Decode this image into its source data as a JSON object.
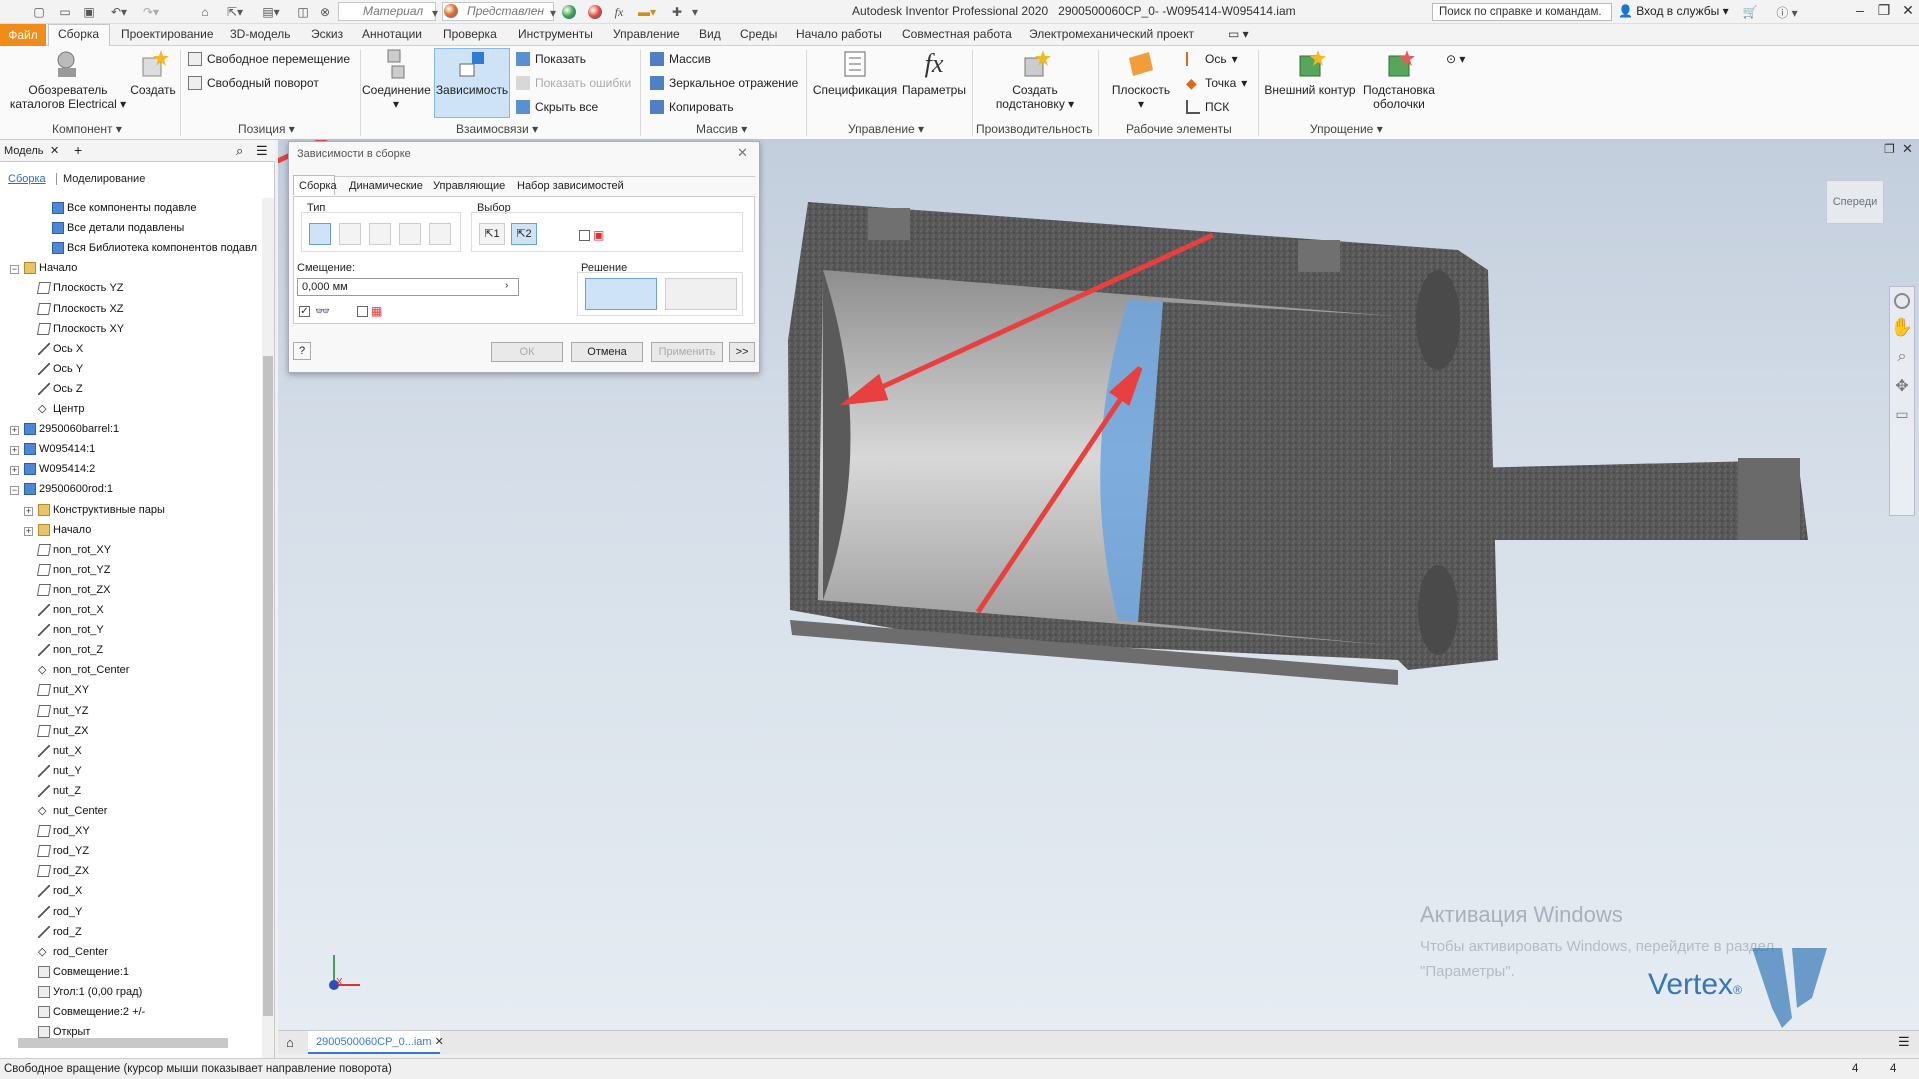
{
  "titlebar": {
    "material_value": "Материал",
    "appearance_value": "Представлен",
    "app_title": "Autodesk Inventor Professional 2020",
    "document_name": "2900500060CP_0-  -W095414-W095414.iam",
    "help_search": "Поиск по справке и командам.",
    "signin": "Вход в службы"
  },
  "menu": {
    "file": "Файл",
    "tabs": [
      "Сборка",
      "Проектирование",
      "3D-модель",
      "Эскиз",
      "Аннотации",
      "Проверка",
      "Инструменты",
      "Управление",
      "Вид",
      "Среды",
      "Начало работы",
      "Совместная работа",
      "Электромеханический проект"
    ]
  },
  "ribbon": {
    "catalog_browser": "Обозреватель каталогов Electrical",
    "create": "Создать",
    "free_move": "Свободное перемещение",
    "free_rotate": "Свободный поворот",
    "joint": "Соединение",
    "constraint": "Зависимость",
    "show": "Показать",
    "show_errors": "Показать ошибки",
    "hide_all": "Скрыть все",
    "pattern": "Массив",
    "mirror": "Зеркальное отражение",
    "copy": "Копировать",
    "bom": "Спецификация",
    "parameters": "Параметры",
    "create_substitute": "Создать подстановку",
    "plane": "Плоскость",
    "axis": "Ось",
    "point": "Точка",
    "ucs": "ПСК",
    "shrinkwrap": "Внешний контур",
    "shrinkwrap_sub": "Подстановка оболочки",
    "groups": {
      "component": "Компонент",
      "position": "Позиция",
      "relationships": "Взаимосвязи",
      "pattern": "Массив",
      "manage": "Управление",
      "productivity": "Производительность",
      "work_features": "Рабочие элементы",
      "simplification": "Упрощение"
    }
  },
  "browser": {
    "model_tab": "Модель",
    "assembly": "Сборка",
    "modeling": "Моделирование",
    "items": [
      {
        "label": "Все компоненты подавле",
        "indent": 3,
        "icon": "part"
      },
      {
        "label": "Все детали подавлены",
        "indent": 3,
        "icon": "part"
      },
      {
        "label": "Вся Библиотека компонентов подавл",
        "indent": 3,
        "icon": "part"
      },
      {
        "label": "Начало",
        "indent": 1,
        "icon": "folder",
        "exp": "−"
      },
      {
        "label": "Плоскость YZ",
        "indent": 2,
        "icon": "plane"
      },
      {
        "label": "Плоскость XZ",
        "indent": 2,
        "icon": "plane"
      },
      {
        "label": "Плоскость XY",
        "indent": 2,
        "icon": "plane"
      },
      {
        "label": "Ось X",
        "indent": 2,
        "icon": "axis"
      },
      {
        "label": "Ось Y",
        "indent": 2,
        "icon": "axis"
      },
      {
        "label": "Ось Z",
        "indent": 2,
        "icon": "axis"
      },
      {
        "label": "Центр",
        "indent": 2,
        "icon": "point"
      },
      {
        "label": "2950060barrel:1",
        "indent": 1,
        "icon": "part",
        "exp": "+"
      },
      {
        "label": "W095414:1",
        "indent": 1,
        "icon": "part",
        "exp": "+"
      },
      {
        "label": "W095414:2",
        "indent": 1,
        "icon": "part",
        "exp": "+"
      },
      {
        "label": "29500600rod:1",
        "indent": 1,
        "icon": "part",
        "exp": "−"
      },
      {
        "label": "Конструктивные пары",
        "indent": 2,
        "icon": "folder",
        "exp": "+"
      },
      {
        "label": "Начало",
        "indent": 2,
        "icon": "folder",
        "exp": "+"
      },
      {
        "label": "non_rot_XY",
        "indent": 2,
        "icon": "plane"
      },
      {
        "label": "non_rot_YZ",
        "indent": 2,
        "icon": "plane"
      },
      {
        "label": "non_rot_ZX",
        "indent": 2,
        "icon": "plane"
      },
      {
        "label": "non_rot_X",
        "indent": 2,
        "icon": "axis"
      },
      {
        "label": "non_rot_Y",
        "indent": 2,
        "icon": "axis"
      },
      {
        "label": "non_rot_Z",
        "indent": 2,
        "icon": "axis"
      },
      {
        "label": "non_rot_Center",
        "indent": 2,
        "icon": "point"
      },
      {
        "label": "nut_XY",
        "indent": 2,
        "icon": "plane"
      },
      {
        "label": "nut_YZ",
        "indent": 2,
        "icon": "plane"
      },
      {
        "label": "nut_ZX",
        "indent": 2,
        "icon": "plane"
      },
      {
        "label": "nut_X",
        "indent": 2,
        "icon": "axis"
      },
      {
        "label": "nut_Y",
        "indent": 2,
        "icon": "axis"
      },
      {
        "label": "nut_Z",
        "indent": 2,
        "icon": "axis"
      },
      {
        "label": "nut_Center",
        "indent": 2,
        "icon": "point"
      },
      {
        "label": "rod_XY",
        "indent": 2,
        "icon": "plane"
      },
      {
        "label": "rod_YZ",
        "indent": 2,
        "icon": "plane"
      },
      {
        "label": "rod_ZX",
        "indent": 2,
        "icon": "plane"
      },
      {
        "label": "rod_X",
        "indent": 2,
        "icon": "axis"
      },
      {
        "label": "rod_Y",
        "indent": 2,
        "icon": "axis"
      },
      {
        "label": "rod_Z",
        "indent": 2,
        "icon": "axis"
      },
      {
        "label": "rod_Center",
        "indent": 2,
        "icon": "point"
      },
      {
        "label": "Совмещение:1",
        "indent": 2,
        "icon": "mate"
      },
      {
        "label": "Угол:1 (0,00 град)",
        "indent": 2,
        "icon": "mate"
      },
      {
        "label": "Совмещение:2 +/-",
        "indent": 2,
        "icon": "mate"
      },
      {
        "label": "Открыт",
        "indent": 2,
        "icon": "mate"
      }
    ]
  },
  "dialog": {
    "title": "Зависимости в сборке",
    "tabs": [
      "Сборка",
      "Динамические",
      "Управляющие",
      "Набор зависимостей"
    ],
    "type_label": "Тип",
    "selection_label": "Выбор",
    "offset_label": "Смещение:",
    "offset_value": "0,000 мм",
    "solution_label": "Решение",
    "ok": "ОК",
    "cancel": "Отмена",
    "apply": "Применить",
    "more": ">>",
    "help": "?",
    "sel1": "1",
    "sel2": "2"
  },
  "viewport": {
    "viewcube": "Спереди",
    "watermark_title": "Активация Windows",
    "watermark_line1": "Чтобы активировать Windows, перейдите в раздел",
    "watermark_line2": "\"Параметры\".",
    "logo": "Vertex",
    "axis_x": "X"
  },
  "doctab": {
    "name": "2900500060CP_0...iam"
  },
  "status": {
    "text": "Свободное вращение (курсор мыши показывает направление поворота)",
    "n1": "4",
    "n2": "4"
  },
  "colors": {
    "accent_orange": "#f08c1a",
    "arrow_red": "#e84040",
    "ribbon_blue": "#2f7bd6"
  }
}
